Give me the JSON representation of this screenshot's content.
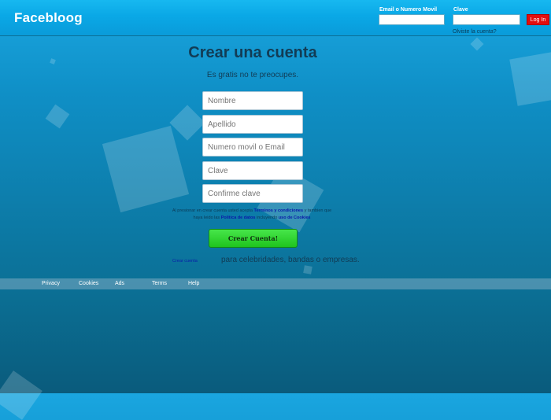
{
  "header": {
    "logo": "Facebloog",
    "email_label": "Email o Numero Movil",
    "password_label": "Clave",
    "login_button": "Log In",
    "forgot_link": "Olviste la cuenta?"
  },
  "signup": {
    "title": "Crear una cuenta",
    "subtitle": "Es gratis no te preocupes.",
    "fields": {
      "first_name": "Nombre",
      "last_name": "Apellido",
      "contact": "Numero movil o Email",
      "password": "Clave",
      "confirm": "Confirme clave"
    },
    "terms": {
      "prefix": "Al presionar en crear cuenta usted acepta",
      "link_terms": "Terminos y condiciones",
      "middle": "y tambien que haya leido las",
      "link_policy": "Politica de datos",
      "middle2": "incluyendo",
      "link_cookies": "uso de Cookies"
    },
    "create_button": "Crear Cuenta!",
    "create_page_link": "Crear cuenta",
    "promo_text": "para celebridades, bandas o empresas."
  },
  "footer": {
    "links": [
      "Privacy",
      "Cookies",
      "Ads",
      "Terms",
      "Help"
    ]
  },
  "colors": {
    "accent_red": "#e30e0e",
    "create_green": "#2fd32f",
    "background_blue": "#0f8fc6"
  }
}
